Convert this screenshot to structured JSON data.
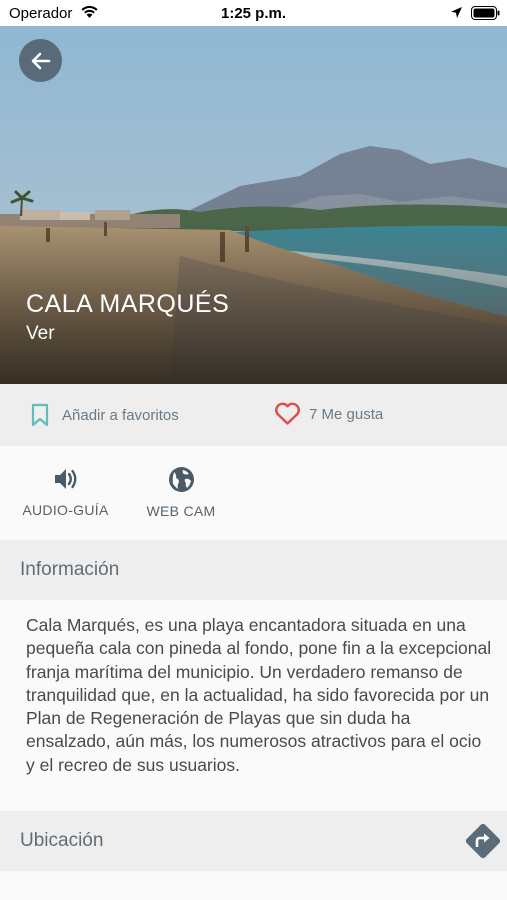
{
  "status_bar": {
    "carrier": "Operador",
    "time": "1:25 p.m."
  },
  "hero": {
    "title": "CALA MARQUÉS",
    "subtitle": "Ver"
  },
  "actions": {
    "favorite_label": "Añadir a favoritos",
    "likes_label": "7 Me gusta"
  },
  "tools": {
    "audio_label": "AUDIO-GUÍA",
    "webcam_label": "WEB CAM"
  },
  "info": {
    "header": "Información",
    "body": "Cala Marqués, es una playa encantadora situada en una pequeña cala con pineda al fondo, pone fin a la excepcional franja marítima del municipio. Un verdadero remanso de tranquilidad que, en la actualidad, ha sido favorecida por un Plan de Regeneración de Playas que sin duda ha ensalzado, aún más, los numerosos atractivos para el ocio y el recreo de sus usuarios."
  },
  "location": {
    "header": "Ubicación"
  },
  "colors": {
    "accent_teal": "#5fbfb7",
    "like_red": "#e04b4b",
    "icon_dark": "#4a5a66",
    "directions_bg": "#5a6c7a"
  }
}
